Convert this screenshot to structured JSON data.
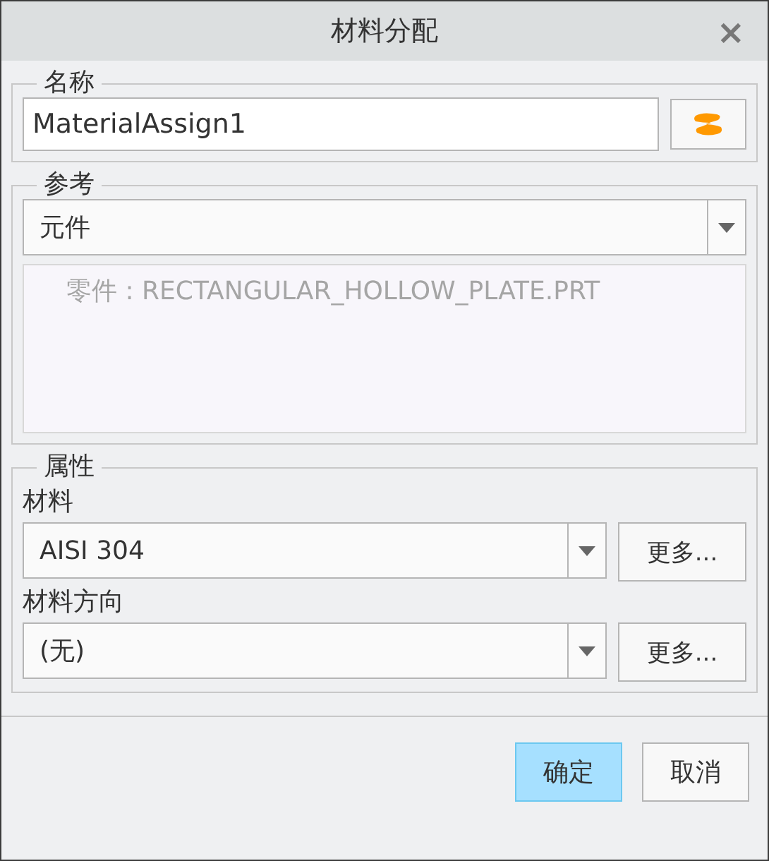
{
  "window": {
    "title": "材料分配",
    "close": "×"
  },
  "name_section": {
    "legend": "名称",
    "value": "MaterialAssign1"
  },
  "reference_section": {
    "legend": "参考",
    "dropdown": "元件",
    "items": [
      "零件 : RECTANGULAR_HOLLOW_PLATE.PRT"
    ]
  },
  "properties_section": {
    "legend": "属性",
    "fields": [
      {
        "label": "材料",
        "value": "AISI 304",
        "button": "更多..."
      },
      {
        "label": "材料方向",
        "value": "(无)",
        "button": "更多..."
      }
    ]
  },
  "buttons": [
    {
      "label": "确定",
      "default": true
    },
    {
      "label": "取消",
      "default": false
    }
  ]
}
